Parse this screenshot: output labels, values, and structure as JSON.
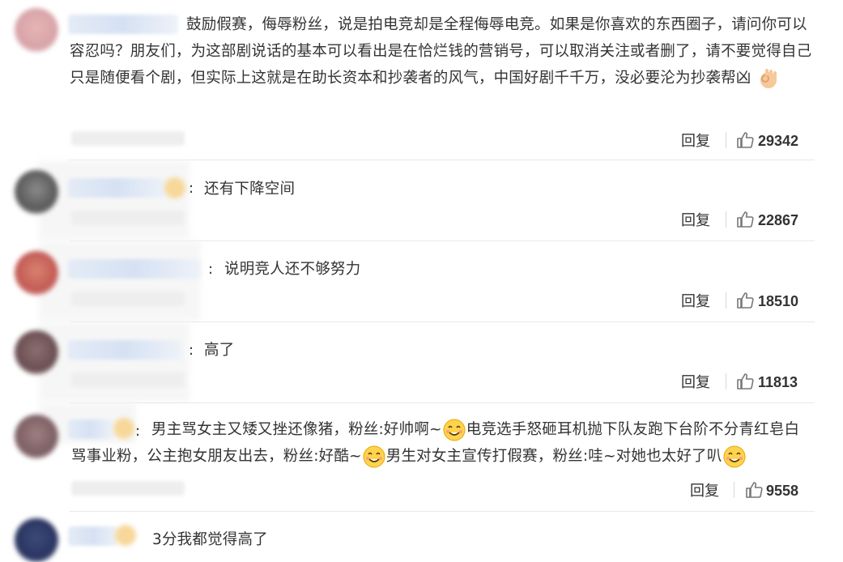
{
  "comments": [
    {
      "text": "鼓励假赛，侮辱粉丝，说是拍电竞却是全程侮辱电竞。如果是你喜欢的东西圈子，请问你可以容忍吗？朋友们，为这部剧说话的基本可以看出是在恰烂钱的营销号，可以取消关注或者删了，请不要觉得自己只是随便看个剧，但实际上这就是在助长资本和抄袭者的风气，中国好剧千千万，没必要沦为抄袭帮凶",
      "emoji": "ok-hand-emoji",
      "reply": "回复",
      "likes": "29342"
    },
    {
      "colon": ":",
      "text": "还有下降空间",
      "reply": "回复",
      "likes": "22867"
    },
    {
      "colon": ":",
      "text": "说明竞人还不够努力",
      "reply": "回复",
      "likes": "18510"
    },
    {
      "colon": ":",
      "text": "高了",
      "reply": "回复",
      "likes": "11813"
    },
    {
      "colon": ":",
      "text_line1_a": "男主骂女主又矮又挫还像猪，粉丝:好帅啊~",
      "text_line1_b": "电竞选手怒砸耳机抛下队友跑下台阶不分青红皂白",
      "text_line2_a": "骂事业粉，公主抱女朋友出去，粉丝:好酷~",
      "text_line2_b": "男生对女主宣传打假赛，粉丝:哇~对她也太好了叭",
      "emoji": "smitten-face-emoji",
      "reply": "回复",
      "likes": "9558"
    },
    {
      "text": "3分我都觉得高了"
    }
  ],
  "icons": {
    "like": "thumbs-up-icon"
  },
  "colors": {
    "text": "#333333",
    "divider": "#e8e8e8",
    "blurred_name": "#d5e1f3"
  }
}
